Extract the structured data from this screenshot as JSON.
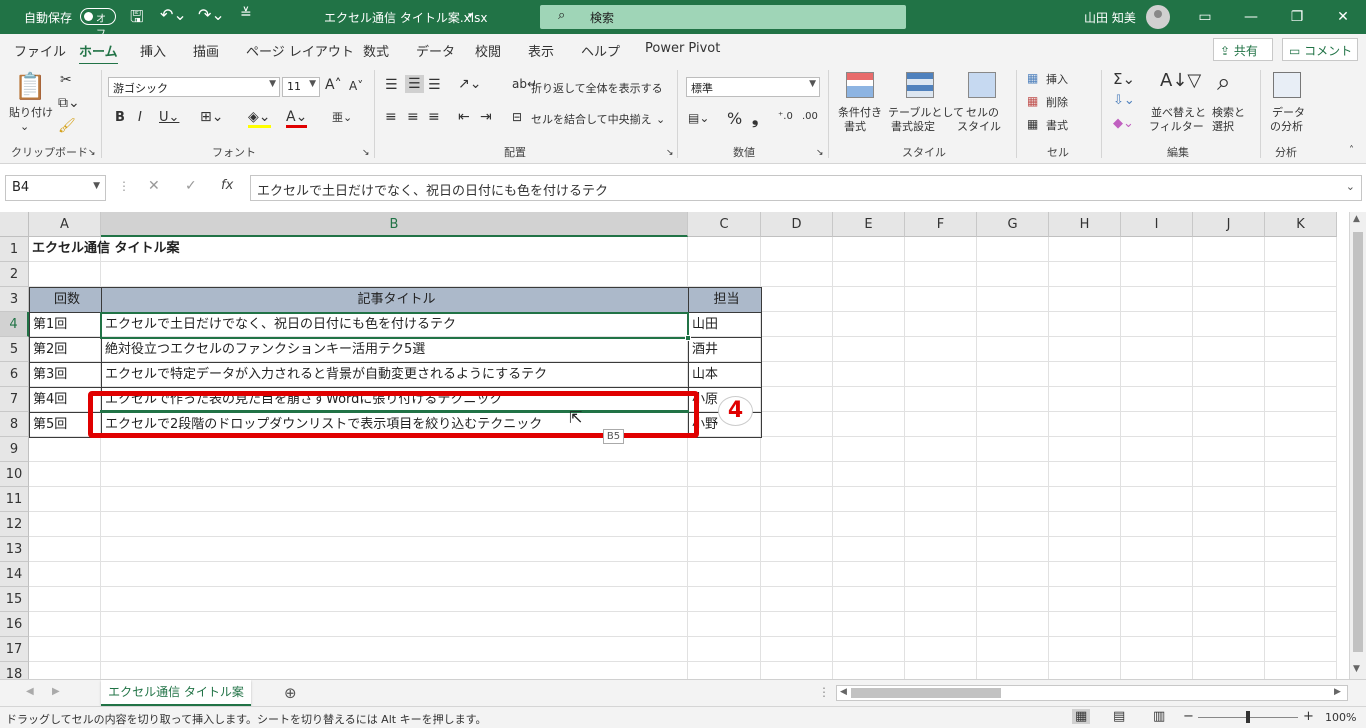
{
  "titlebar": {
    "autosave_label": "自動保存",
    "autosave_state": "オフ",
    "filename": "エクセル通信 タイトル案.xlsx",
    "search_placeholder": "検索",
    "user_name": "山田 知美",
    "accent": "#217346"
  },
  "tabs": [
    "ファイル",
    "ホーム",
    "挿入",
    "描画",
    "ページ レイアウト",
    "数式",
    "データ",
    "校閲",
    "表示",
    "ヘルプ",
    "Power Pivot"
  ],
  "active_tab": "ホーム",
  "share_label": "共有",
  "comment_label": "コメント",
  "ribbon": {
    "clipboard": {
      "paste": "貼り付け",
      "group": "クリップボード"
    },
    "font": {
      "name": "游ゴシック",
      "size": "11",
      "group": "フォント"
    },
    "alignment": {
      "wrap": "折り返して全体を表示する",
      "merge": "セルを結合して中央揃え",
      "group": "配置"
    },
    "number": {
      "format": "標準",
      "group": "数値"
    },
    "styles": {
      "conditional_1": "条件付き",
      "conditional_2": "書式",
      "table_1": "テーブルとして",
      "table_2": "書式設定",
      "cell_1": "セルの",
      "cell_2": "スタイル",
      "group": "スタイル"
    },
    "cells": {
      "insert": "挿入",
      "delete": "削除",
      "format": "書式",
      "group": "セル"
    },
    "editing": {
      "sort_1": "並べ替えと",
      "sort_2": "フィルター",
      "find_1": "検索と",
      "find_2": "選択",
      "group": "編集"
    },
    "analysis": {
      "analyze_1": "データ",
      "analyze_2": "の分析",
      "group": "分析"
    }
  },
  "formula_bar": {
    "name_box": "B4",
    "formula": "エクセルで土日だけでなく、祝日の日付にも色を付けるテク"
  },
  "columns": [
    "A",
    "B",
    "C",
    "D",
    "E",
    "F",
    "G",
    "H",
    "I",
    "J",
    "K"
  ],
  "rows": [
    "1",
    "2",
    "3",
    "4",
    "5",
    "6",
    "7",
    "8",
    "9",
    "10",
    "11",
    "12",
    "13",
    "14",
    "15",
    "16",
    "17",
    "18"
  ],
  "sheet": {
    "title": "エクセル通信 タイトル案",
    "table_header": [
      "回数",
      "記事タイトル",
      "担当"
    ],
    "table_rows": [
      [
        "第1回",
        "エクセルで土日だけでなく、祝日の日付にも色を付けるテク",
        "山田"
      ],
      [
        "第2回",
        "絶対役立つエクセルのファンクションキー活用テク5選",
        "酒井"
      ],
      [
        "第3回",
        "エクセルで特定データが入力されると背景が自動変更されるようにするテク",
        "山本"
      ],
      [
        "第4回",
        "エクセルで作った表の見た目を崩さずWordに張り付けるテクニック",
        "小原"
      ],
      [
        "第5回",
        "エクセルで2段階のドロップダウンリストで表示項目を絞り込むテクニック",
        "小野"
      ]
    ]
  },
  "annotation": {
    "number": "4",
    "drag_tooltip": "B5",
    "color": "#e00000"
  },
  "sheet_tab": "エクセル通信 タイトル案",
  "status": {
    "message": "ドラッグしてセルの内容を切り取って挿入します。シートを切り替えるには Alt キーを押します。",
    "zoom": "100%"
  }
}
